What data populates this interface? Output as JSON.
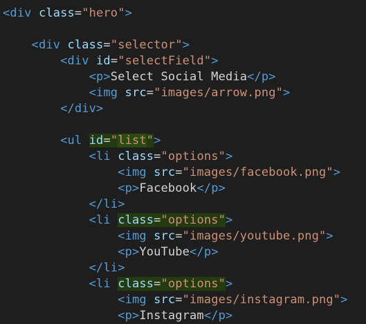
{
  "editor": {
    "colors": {
      "background": "#1e1e1e",
      "tag": "#569cd6",
      "attribute": "#9cdcfe",
      "string": "#ce9178",
      "text": "#d4d4d4",
      "highlight": "#2d4a12"
    },
    "lines": [
      {
        "tokens": [
          {
            "t": "<",
            "c": "punct"
          },
          {
            "t": "div",
            "c": "tag"
          },
          {
            "t": " "
          },
          {
            "t": "class",
            "c": "attr"
          },
          {
            "t": "=",
            "c": "eq"
          },
          {
            "t": "\"hero\"",
            "c": "str"
          },
          {
            "t": ">",
            "c": "punct"
          }
        ]
      },
      {
        "tokens": []
      },
      {
        "tokens": [
          {
            "t": "    "
          },
          {
            "t": "<",
            "c": "punct"
          },
          {
            "t": "div",
            "c": "tag"
          },
          {
            "t": " "
          },
          {
            "t": "class",
            "c": "attr"
          },
          {
            "t": "=",
            "c": "eq"
          },
          {
            "t": "\"selector\"",
            "c": "str"
          },
          {
            "t": ">",
            "c": "punct"
          }
        ]
      },
      {
        "tokens": [
          {
            "t": "        "
          },
          {
            "t": "<",
            "c": "punct"
          },
          {
            "t": "div",
            "c": "tag"
          },
          {
            "t": " "
          },
          {
            "t": "id",
            "c": "attr"
          },
          {
            "t": "=",
            "c": "eq"
          },
          {
            "t": "\"selectField\"",
            "c": "str"
          },
          {
            "t": ">",
            "c": "punct"
          }
        ]
      },
      {
        "tokens": [
          {
            "t": "            "
          },
          {
            "t": "<",
            "c": "punct"
          },
          {
            "t": "p",
            "c": "tag"
          },
          {
            "t": ">",
            "c": "punct"
          },
          {
            "t": "Select Social Media",
            "c": "text"
          },
          {
            "t": "</",
            "c": "punct"
          },
          {
            "t": "p",
            "c": "tag"
          },
          {
            "t": ">",
            "c": "punct"
          }
        ]
      },
      {
        "tokens": [
          {
            "t": "            "
          },
          {
            "t": "<",
            "c": "punct"
          },
          {
            "t": "img",
            "c": "tag"
          },
          {
            "t": " "
          },
          {
            "t": "src",
            "c": "attr"
          },
          {
            "t": "=",
            "c": "eq"
          },
          {
            "t": "\"images/arrow.png\"",
            "c": "str"
          },
          {
            "t": ">",
            "c": "punct"
          }
        ]
      },
      {
        "tokens": [
          {
            "t": "        "
          },
          {
            "t": "</",
            "c": "punct"
          },
          {
            "t": "div",
            "c": "tag"
          },
          {
            "t": ">",
            "c": "punct"
          }
        ]
      },
      {
        "tokens": []
      },
      {
        "tokens": [
          {
            "t": "        "
          },
          {
            "t": "<",
            "c": "punct"
          },
          {
            "t": "ul",
            "c": "tag"
          },
          {
            "t": " "
          },
          {
            "t": "id",
            "c": "attr",
            "hl": "sel"
          },
          {
            "t": "=",
            "c": "eq",
            "hl": "sel"
          },
          {
            "t": "\"",
            "c": "str",
            "hl": "sel"
          },
          {
            "t": "list",
            "c": "str",
            "hl": "word"
          },
          {
            "t": "\"",
            "c": "str",
            "hl": "sel"
          },
          {
            "t": ">",
            "c": "punct"
          }
        ]
      },
      {
        "tokens": [
          {
            "t": "            "
          },
          {
            "t": "<",
            "c": "punct"
          },
          {
            "t": "li",
            "c": "tag"
          },
          {
            "t": " "
          },
          {
            "t": "class",
            "c": "attr"
          },
          {
            "t": "=",
            "c": "eq"
          },
          {
            "t": "\"options\"",
            "c": "str"
          },
          {
            "t": ">",
            "c": "punct"
          }
        ]
      },
      {
        "tokens": [
          {
            "t": "                "
          },
          {
            "t": "<",
            "c": "punct"
          },
          {
            "t": "img",
            "c": "tag"
          },
          {
            "t": " "
          },
          {
            "t": "src",
            "c": "attr"
          },
          {
            "t": "=",
            "c": "eq"
          },
          {
            "t": "\"images/facebook.png\"",
            "c": "str"
          },
          {
            "t": ">",
            "c": "punct"
          }
        ]
      },
      {
        "tokens": [
          {
            "t": "                "
          },
          {
            "t": "<",
            "c": "punct"
          },
          {
            "t": "p",
            "c": "tag"
          },
          {
            "t": ">",
            "c": "punct"
          },
          {
            "t": "Facebook",
            "c": "text"
          },
          {
            "t": "</",
            "c": "punct"
          },
          {
            "t": "p",
            "c": "tag"
          },
          {
            "t": ">",
            "c": "punct"
          }
        ]
      },
      {
        "tokens": [
          {
            "t": "            "
          },
          {
            "t": "</",
            "c": "punct"
          },
          {
            "t": "li",
            "c": "tag"
          },
          {
            "t": ">",
            "c": "punct"
          }
        ]
      },
      {
        "tokens": [
          {
            "t": "            "
          },
          {
            "t": "<",
            "c": "punct"
          },
          {
            "t": "li",
            "c": "tag"
          },
          {
            "t": " "
          },
          {
            "t": "class",
            "c": "attr",
            "hl": "sel"
          },
          {
            "t": "=",
            "c": "eq",
            "hl": "sel"
          },
          {
            "t": "\"options\"",
            "c": "str",
            "hl": "sel"
          },
          {
            "t": ">",
            "c": "punct"
          }
        ]
      },
      {
        "tokens": [
          {
            "t": "                "
          },
          {
            "t": "<",
            "c": "punct"
          },
          {
            "t": "img",
            "c": "tag"
          },
          {
            "t": " "
          },
          {
            "t": "src",
            "c": "attr"
          },
          {
            "t": "=",
            "c": "eq"
          },
          {
            "t": "\"images/youtube.png\"",
            "c": "str"
          },
          {
            "t": ">",
            "c": "punct"
          }
        ]
      },
      {
        "tokens": [
          {
            "t": "                "
          },
          {
            "t": "<",
            "c": "punct"
          },
          {
            "t": "p",
            "c": "tag"
          },
          {
            "t": ">",
            "c": "punct"
          },
          {
            "t": "YouTube",
            "c": "text"
          },
          {
            "t": "</",
            "c": "punct"
          },
          {
            "t": "p",
            "c": "tag"
          },
          {
            "t": ">",
            "c": "punct"
          }
        ]
      },
      {
        "tokens": [
          {
            "t": "            "
          },
          {
            "t": "</",
            "c": "punct"
          },
          {
            "t": "li",
            "c": "tag"
          },
          {
            "t": ">",
            "c": "punct"
          }
        ]
      },
      {
        "tokens": [
          {
            "t": "            "
          },
          {
            "t": "<",
            "c": "punct"
          },
          {
            "t": "li",
            "c": "tag"
          },
          {
            "t": " "
          },
          {
            "t": "class",
            "c": "attr",
            "hl": "sel"
          },
          {
            "t": "=",
            "c": "eq",
            "hl": "sel"
          },
          {
            "t": "\"options\"",
            "c": "str",
            "hl": "sel"
          },
          {
            "t": ">",
            "c": "punct"
          }
        ]
      },
      {
        "tokens": [
          {
            "t": "                "
          },
          {
            "t": "<",
            "c": "punct"
          },
          {
            "t": "img",
            "c": "tag"
          },
          {
            "t": " "
          },
          {
            "t": "src",
            "c": "attr"
          },
          {
            "t": "=",
            "c": "eq"
          },
          {
            "t": "\"images/instagram.png\"",
            "c": "str"
          },
          {
            "t": ">",
            "c": "punct"
          }
        ]
      },
      {
        "tokens": [
          {
            "t": "                "
          },
          {
            "t": "<",
            "c": "punct"
          },
          {
            "t": "p",
            "c": "tag"
          },
          {
            "t": ">",
            "c": "punct"
          },
          {
            "t": "Instagram",
            "c": "text"
          },
          {
            "t": "</",
            "c": "punct"
          },
          {
            "t": "p",
            "c": "tag"
          },
          {
            "t": ">",
            "c": "punct"
          }
        ]
      }
    ]
  }
}
